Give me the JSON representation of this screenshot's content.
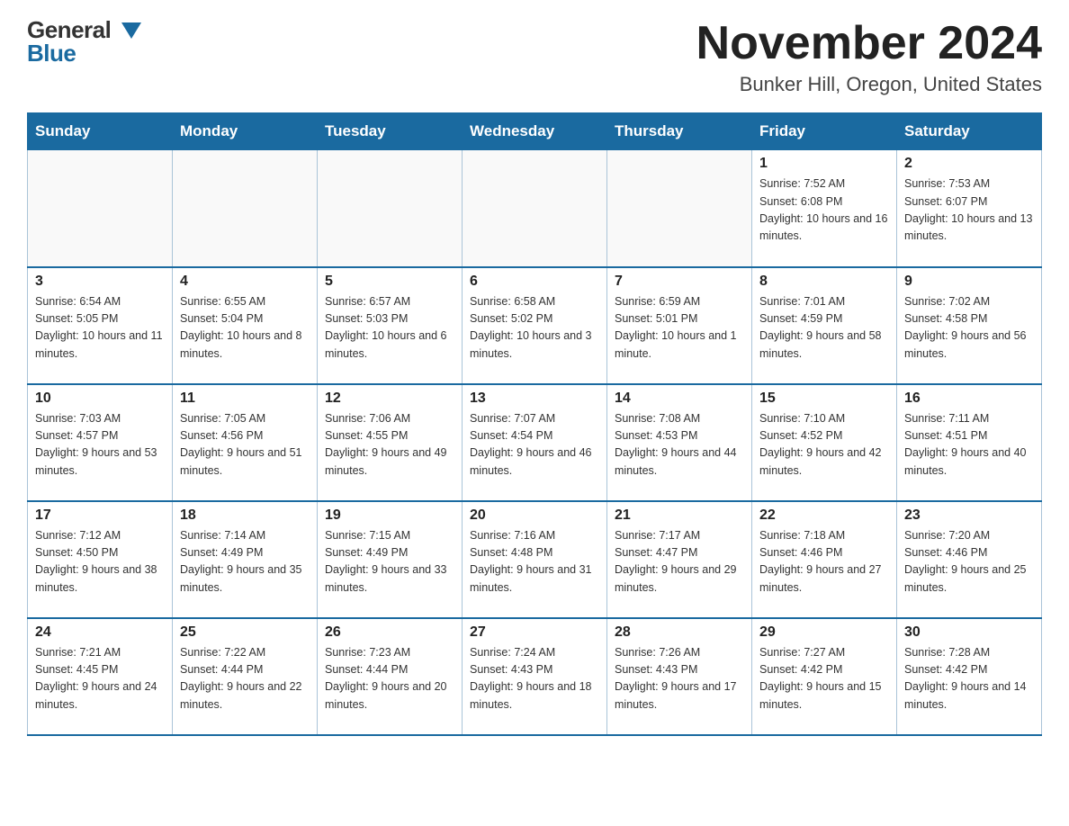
{
  "header": {
    "logo_general": "General",
    "logo_blue": "Blue",
    "title": "November 2024",
    "subtitle": "Bunker Hill, Oregon, United States"
  },
  "days_of_week": [
    "Sunday",
    "Monday",
    "Tuesday",
    "Wednesday",
    "Thursday",
    "Friday",
    "Saturday"
  ],
  "weeks": [
    [
      {
        "day": "",
        "info": ""
      },
      {
        "day": "",
        "info": ""
      },
      {
        "day": "",
        "info": ""
      },
      {
        "day": "",
        "info": ""
      },
      {
        "day": "",
        "info": ""
      },
      {
        "day": "1",
        "info": "Sunrise: 7:52 AM\nSunset: 6:08 PM\nDaylight: 10 hours and 16 minutes."
      },
      {
        "day": "2",
        "info": "Sunrise: 7:53 AM\nSunset: 6:07 PM\nDaylight: 10 hours and 13 minutes."
      }
    ],
    [
      {
        "day": "3",
        "info": "Sunrise: 6:54 AM\nSunset: 5:05 PM\nDaylight: 10 hours and 11 minutes."
      },
      {
        "day": "4",
        "info": "Sunrise: 6:55 AM\nSunset: 5:04 PM\nDaylight: 10 hours and 8 minutes."
      },
      {
        "day": "5",
        "info": "Sunrise: 6:57 AM\nSunset: 5:03 PM\nDaylight: 10 hours and 6 minutes."
      },
      {
        "day": "6",
        "info": "Sunrise: 6:58 AM\nSunset: 5:02 PM\nDaylight: 10 hours and 3 minutes."
      },
      {
        "day": "7",
        "info": "Sunrise: 6:59 AM\nSunset: 5:01 PM\nDaylight: 10 hours and 1 minute."
      },
      {
        "day": "8",
        "info": "Sunrise: 7:01 AM\nSunset: 4:59 PM\nDaylight: 9 hours and 58 minutes."
      },
      {
        "day": "9",
        "info": "Sunrise: 7:02 AM\nSunset: 4:58 PM\nDaylight: 9 hours and 56 minutes."
      }
    ],
    [
      {
        "day": "10",
        "info": "Sunrise: 7:03 AM\nSunset: 4:57 PM\nDaylight: 9 hours and 53 minutes."
      },
      {
        "day": "11",
        "info": "Sunrise: 7:05 AM\nSunset: 4:56 PM\nDaylight: 9 hours and 51 minutes."
      },
      {
        "day": "12",
        "info": "Sunrise: 7:06 AM\nSunset: 4:55 PM\nDaylight: 9 hours and 49 minutes."
      },
      {
        "day": "13",
        "info": "Sunrise: 7:07 AM\nSunset: 4:54 PM\nDaylight: 9 hours and 46 minutes."
      },
      {
        "day": "14",
        "info": "Sunrise: 7:08 AM\nSunset: 4:53 PM\nDaylight: 9 hours and 44 minutes."
      },
      {
        "day": "15",
        "info": "Sunrise: 7:10 AM\nSunset: 4:52 PM\nDaylight: 9 hours and 42 minutes."
      },
      {
        "day": "16",
        "info": "Sunrise: 7:11 AM\nSunset: 4:51 PM\nDaylight: 9 hours and 40 minutes."
      }
    ],
    [
      {
        "day": "17",
        "info": "Sunrise: 7:12 AM\nSunset: 4:50 PM\nDaylight: 9 hours and 38 minutes."
      },
      {
        "day": "18",
        "info": "Sunrise: 7:14 AM\nSunset: 4:49 PM\nDaylight: 9 hours and 35 minutes."
      },
      {
        "day": "19",
        "info": "Sunrise: 7:15 AM\nSunset: 4:49 PM\nDaylight: 9 hours and 33 minutes."
      },
      {
        "day": "20",
        "info": "Sunrise: 7:16 AM\nSunset: 4:48 PM\nDaylight: 9 hours and 31 minutes."
      },
      {
        "day": "21",
        "info": "Sunrise: 7:17 AM\nSunset: 4:47 PM\nDaylight: 9 hours and 29 minutes."
      },
      {
        "day": "22",
        "info": "Sunrise: 7:18 AM\nSunset: 4:46 PM\nDaylight: 9 hours and 27 minutes."
      },
      {
        "day": "23",
        "info": "Sunrise: 7:20 AM\nSunset: 4:46 PM\nDaylight: 9 hours and 25 minutes."
      }
    ],
    [
      {
        "day": "24",
        "info": "Sunrise: 7:21 AM\nSunset: 4:45 PM\nDaylight: 9 hours and 24 minutes."
      },
      {
        "day": "25",
        "info": "Sunrise: 7:22 AM\nSunset: 4:44 PM\nDaylight: 9 hours and 22 minutes."
      },
      {
        "day": "26",
        "info": "Sunrise: 7:23 AM\nSunset: 4:44 PM\nDaylight: 9 hours and 20 minutes."
      },
      {
        "day": "27",
        "info": "Sunrise: 7:24 AM\nSunset: 4:43 PM\nDaylight: 9 hours and 18 minutes."
      },
      {
        "day": "28",
        "info": "Sunrise: 7:26 AM\nSunset: 4:43 PM\nDaylight: 9 hours and 17 minutes."
      },
      {
        "day": "29",
        "info": "Sunrise: 7:27 AM\nSunset: 4:42 PM\nDaylight: 9 hours and 15 minutes."
      },
      {
        "day": "30",
        "info": "Sunrise: 7:28 AM\nSunset: 4:42 PM\nDaylight: 9 hours and 14 minutes."
      }
    ]
  ]
}
